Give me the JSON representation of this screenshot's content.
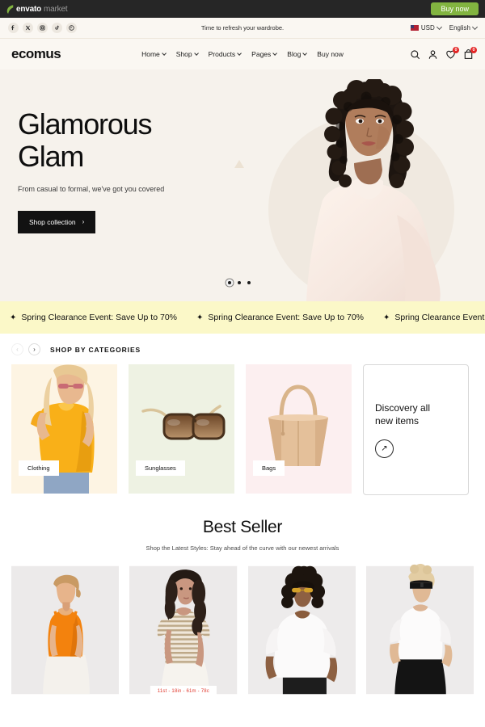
{
  "envato_bar": {
    "logo_bold": "envato",
    "logo_light": "market",
    "buy_now_label": "Buy now"
  },
  "top_bar": {
    "message": "Time to refresh your wardrobe.",
    "socials": [
      {
        "name": "facebook-icon",
        "glyph": "f"
      },
      {
        "name": "x-twitter-icon",
        "glyph": "𝕏"
      },
      {
        "name": "instagram-icon",
        "glyph": "▣"
      },
      {
        "name": "tiktok-icon",
        "glyph": "♪"
      },
      {
        "name": "pinterest-icon",
        "glyph": "Ⓟ"
      }
    ],
    "currency": "USD",
    "language": "English"
  },
  "header": {
    "logo": "ecomus",
    "nav": [
      {
        "label": "Home",
        "has_dropdown": true
      },
      {
        "label": "Shop",
        "has_dropdown": true
      },
      {
        "label": "Products",
        "has_dropdown": true
      },
      {
        "label": "Pages",
        "has_dropdown": true
      },
      {
        "label": "Blog",
        "has_dropdown": true
      },
      {
        "label": "Buy now",
        "has_dropdown": false
      }
    ],
    "icons": [
      {
        "name": "search-icon",
        "badge": null
      },
      {
        "name": "account-icon",
        "badge": null
      },
      {
        "name": "wishlist-heart-icon",
        "badge": "0"
      },
      {
        "name": "cart-icon",
        "badge": "0"
      }
    ]
  },
  "hero": {
    "title_line1": "Glamorous",
    "title_line2": "Glam",
    "subtitle": "From casual to formal, we've got you covered",
    "cta_label": "Shop collection",
    "cta_arrow": "›",
    "slides_total": 3,
    "active_slide": 1,
    "bg_color": "#f6f2ec"
  },
  "marquee": {
    "star": "✦",
    "text": "Spring Clearance Event: Save Up to 70%",
    "repeat": 3,
    "bg_color": "#fbf8c8"
  },
  "categories": {
    "section_title": "SHOP BY CATEGORIES",
    "prev_arrow": "‹",
    "next_arrow": "›",
    "cards": [
      {
        "label": "Clothing",
        "bg": "#fdf4e3"
      },
      {
        "label": "Sunglasses",
        "bg": "#eef2e3"
      },
      {
        "label": "Bags",
        "bg": "#fceff0"
      }
    ],
    "discovery": {
      "line1": "Discovery all",
      "line2": "new items",
      "arrow": "↗"
    }
  },
  "best_seller": {
    "title": "Best Seller",
    "subtitle": "Shop the Latest Styles: Stay ahead of the curve with our newest arrivals",
    "products": [
      {
        "name": "orange-tank-top",
        "size_badges": null
      },
      {
        "name": "striped-tee",
        "size_badges": "11st - 18in - 61m - 78c"
      },
      {
        "name": "white-oversized-tee",
        "size_badges": null
      },
      {
        "name": "white-tee-black-skirt",
        "size_badges": null
      }
    ]
  }
}
